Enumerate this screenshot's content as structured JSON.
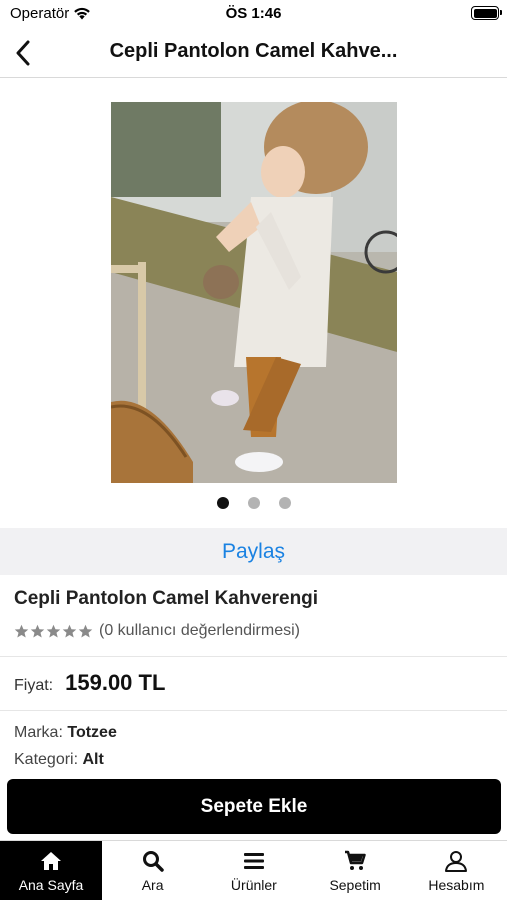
{
  "status_bar": {
    "carrier": "Operatör",
    "time": "ÖS 1:46"
  },
  "header": {
    "title": "Cepli Pantolon Camel Kahve..."
  },
  "gallery": {
    "image_alt": "Cepli Pantolon Camel Kahverengi",
    "page_count": 3,
    "active_index": 0
  },
  "share": {
    "label": "Paylaş"
  },
  "product": {
    "name": "Cepli Pantolon Camel Kahverengi",
    "rating_stars": 5,
    "rating_text": "(0 kullanıcı değerlendirmesi)",
    "price_label": "Fiyat:",
    "price_value": "159.00 TL",
    "brand_label": "Marka:",
    "brand_value": "Totzee",
    "category_label": "Kategori:",
    "category_value": "Alt"
  },
  "cart": {
    "button_label": "Sepete Ekle"
  },
  "tabs": [
    {
      "label": "Ana Sayfa",
      "icon": "home-icon",
      "active": true
    },
    {
      "label": "Ara",
      "icon": "search-icon",
      "active": false
    },
    {
      "label": "Ürünler",
      "icon": "menu-icon",
      "active": false
    },
    {
      "label": "Sepetim",
      "icon": "cart-icon",
      "active": false
    },
    {
      "label": "Hesabım",
      "icon": "user-icon",
      "active": false
    }
  ],
  "colors": {
    "accent": "#1a82e2",
    "primary_button": "#000000",
    "star": "#8a8a8a"
  }
}
